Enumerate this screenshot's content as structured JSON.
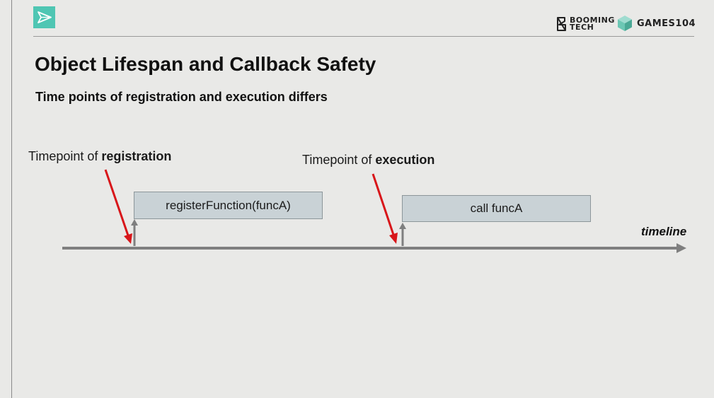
{
  "header": {
    "logo_icon": "paper-plane-icon",
    "brand_booming_line1": "BOOMING",
    "brand_booming_line2": "TECH",
    "brand_games": "GAMES104",
    "accent_color": "#4fc6b3"
  },
  "slide": {
    "title": "Object Lifespan and Callback Safety",
    "subtitle": "Time points of registration and execution differs"
  },
  "diagram": {
    "registration_label_prefix": "Timepoint of ",
    "registration_label_bold": "registration",
    "execution_label_prefix": "Timepoint of ",
    "execution_label_bold": "execution",
    "register_box_text": "registerFunction(funcA)",
    "call_box_text": "call funcA",
    "timeline_label": "timeline",
    "arrow_color": "#d8161a",
    "axis_color": "#7f7f7f",
    "box_fill": "#c9d2d6"
  }
}
